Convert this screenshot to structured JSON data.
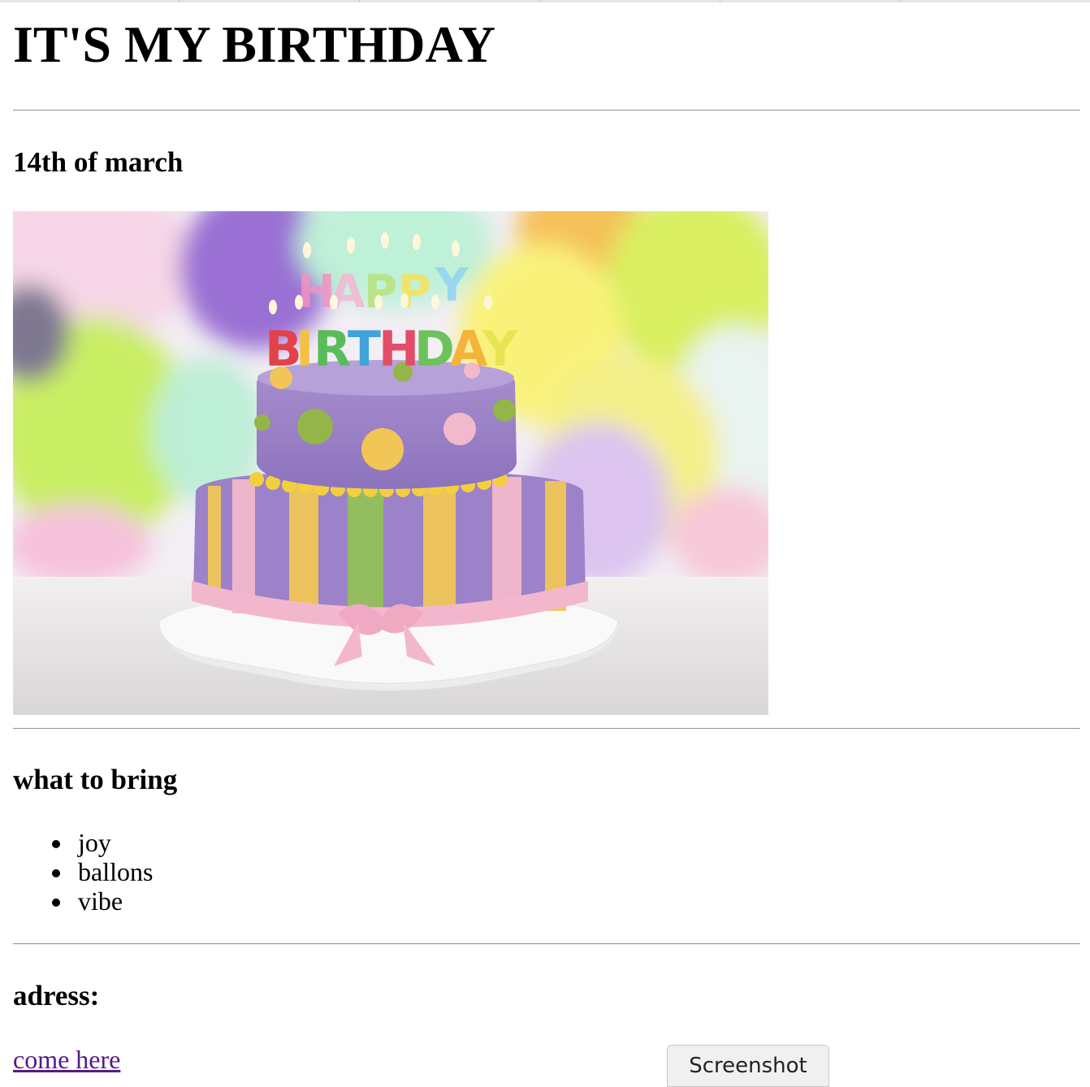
{
  "page": {
    "title": "IT'S MY BIRTHDAY",
    "date_heading": "14th of march",
    "image": {
      "icon": "birthday-cake-image"
    },
    "bring": {
      "heading": "what to bring",
      "items": [
        "joy",
        "ballons",
        "vibe"
      ]
    },
    "address": {
      "heading": "adress:",
      "link_text": "come here"
    }
  },
  "overlay": {
    "screenshot_label": "Screenshot"
  },
  "colors": {
    "link": "#551a8b",
    "rule": "#9a9a9a"
  }
}
